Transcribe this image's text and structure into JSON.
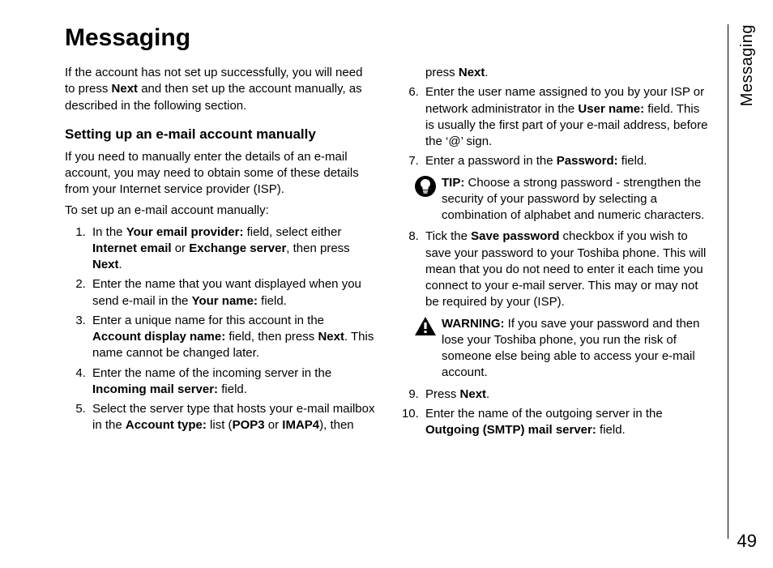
{
  "page": {
    "title": "Messaging",
    "side_tab": "Messaging",
    "page_number": "49"
  },
  "intro": "If the account has not set up successfully, you will need to press ",
  "intro_bold": "Next",
  "intro_after": " and then set up the account manually, as described in the following section.",
  "subhead": "Setting up an e-mail account manually",
  "sub_intro": "If you need to manually enter the details of an e-mail account, you may need to obtain some of these details from your Internet service provider (ISP).",
  "sub_lead": "To set up an e-mail account manually:",
  "step1_a": "In the ",
  "step1_b": "Your email provider:",
  "step1_c": " field, select either ",
  "step1_d": "Internet email",
  "step1_e": " or ",
  "step1_f": "Exchange server",
  "step1_g": ", then press ",
  "step1_h": "Next",
  "step1_i": ".",
  "step2_a": "Enter the name that you want displayed when you send e-mail in the ",
  "step2_b": "Your name:",
  "step2_c": " field.",
  "step3_a": "Enter a unique name for this account in the ",
  "step3_b": "Account display name:",
  "step3_c": " field, then press ",
  "step3_d": "Next",
  "step3_e": ". This name cannot be changed later.",
  "step4_a": "Enter the name of the incoming server in the ",
  "step4_b": "Incoming mail server:",
  "step4_c": " field.",
  "step5_a": "Select the server type that hosts your e-mail mailbox in the ",
  "step5_b": "Account type:",
  "step5_c": " list (",
  "step5_d": "POP3",
  "step5_e": " or ",
  "step5_f": "IMAP4",
  "step5_g": "), then press ",
  "step5_h": "Next",
  "step5_i": ".",
  "step6_a": "Enter the user name assigned to you by your ISP or network administrator in the ",
  "step6_b": "User name:",
  "step6_c": " field. This is usually the first part of your e-mail address, before the ‘@’ sign.",
  "step7_a": "Enter a password in the ",
  "step7_b": "Password:",
  "step7_c": " field.",
  "tip_label": "TIP:",
  "tip_text": " Choose a strong password - strengthen the security of your password by selecting a combination of alphabet and numeric characters.",
  "step8_a": "Tick the ",
  "step8_b": "Save password",
  "step8_c": " checkbox if you wish to save your password to your Toshiba phone. This will mean that you do not need to enter it each time you connect to your e-mail server. This may or may not be required by your (ISP).",
  "warn_label": "WARNING:",
  "warn_text": " If you save your password and then lose your Toshiba phone, you run the risk of someone else being able to access your e-mail account.",
  "step9_a": "Press ",
  "step9_b": "Next",
  "step9_c": ".",
  "step10_a": "Enter the name of the outgoing server in the ",
  "step10_b": "Outgoing (SMTP) mail server:",
  "step10_c": " field."
}
